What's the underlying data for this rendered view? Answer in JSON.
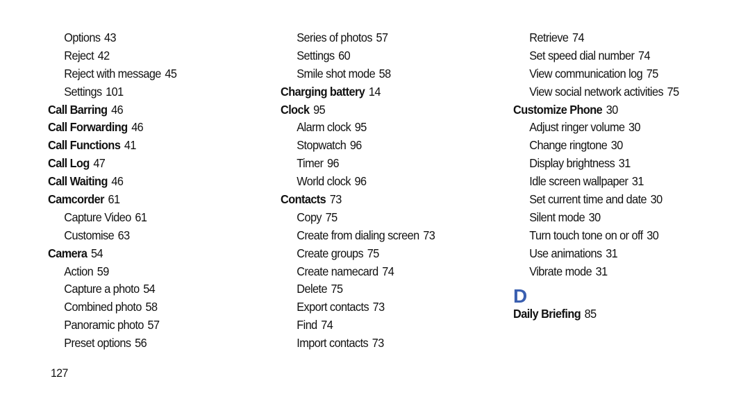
{
  "accent_color": "#3a5fb0",
  "columns": [
    {
      "entries": [
        {
          "term": "Options",
          "page": "43",
          "level": "sub"
        },
        {
          "term": "Reject",
          "page": "42",
          "level": "sub"
        },
        {
          "term": "Reject with message",
          "page": "45",
          "level": "sub"
        },
        {
          "term": "Settings",
          "page": "101",
          "level": "sub"
        },
        {
          "term": "Call Barring",
          "page": "46",
          "level": "main"
        },
        {
          "term": "Call Forwarding",
          "page": "46",
          "level": "main"
        },
        {
          "term": "Call Functions",
          "page": "41",
          "level": "main"
        },
        {
          "term": "Call Log",
          "page": "47",
          "level": "main"
        },
        {
          "term": "Call Waiting",
          "page": "46",
          "level": "main"
        },
        {
          "term": "Camcorder",
          "page": "61",
          "level": "main"
        },
        {
          "term": "Capture Video",
          "page": "61",
          "level": "sub"
        },
        {
          "term": "Customise",
          "page": "63",
          "level": "sub"
        },
        {
          "term": "Camera",
          "page": "54",
          "level": "main"
        },
        {
          "term": "Action",
          "page": "59",
          "level": "sub"
        },
        {
          "term": "Capture a photo",
          "page": "54",
          "level": "sub"
        },
        {
          "term": "Combined photo",
          "page": "58",
          "level": "sub"
        },
        {
          "term": "Panoramic photo",
          "page": "57",
          "level": "sub"
        },
        {
          "term": "Preset options",
          "page": "56",
          "level": "sub"
        }
      ]
    },
    {
      "entries": [
        {
          "term": "Series of photos",
          "page": "57",
          "level": "sub"
        },
        {
          "term": "Settings",
          "page": "60",
          "level": "sub"
        },
        {
          "term": "Smile shot mode",
          "page": "58",
          "level": "sub"
        },
        {
          "term": "Charging battery",
          "page": "14",
          "level": "main"
        },
        {
          "term": "Clock",
          "page": "95",
          "level": "main"
        },
        {
          "term": "Alarm clock",
          "page": "95",
          "level": "sub"
        },
        {
          "term": "Stopwatch",
          "page": "96",
          "level": "sub"
        },
        {
          "term": "Timer",
          "page": "96",
          "level": "sub"
        },
        {
          "term": "World clock",
          "page": "96",
          "level": "sub"
        },
        {
          "term": "Contacts",
          "page": "73",
          "level": "main"
        },
        {
          "term": "Copy",
          "page": "75",
          "level": "sub"
        },
        {
          "term": "Create from dialing screen",
          "page": "73",
          "level": "sub"
        },
        {
          "term": "Create groups",
          "page": "75",
          "level": "sub"
        },
        {
          "term": "Create namecard",
          "page": "74",
          "level": "sub"
        },
        {
          "term": "Delete",
          "page": "75",
          "level": "sub"
        },
        {
          "term": "Export contacts",
          "page": "73",
          "level": "sub"
        },
        {
          "term": "Find",
          "page": "74",
          "level": "sub"
        },
        {
          "term": "Import contacts",
          "page": "73",
          "level": "sub"
        }
      ]
    },
    {
      "entries": [
        {
          "term": "Retrieve",
          "page": "74",
          "level": "sub"
        },
        {
          "term": "Set speed dial number",
          "page": "74",
          "level": "sub"
        },
        {
          "term": "View communication log",
          "page": "75",
          "level": "sub"
        },
        {
          "term": "View social network activities",
          "page": "75",
          "level": "sub"
        },
        {
          "term": "Customize Phone",
          "page": "30",
          "level": "main"
        },
        {
          "term": "Adjust ringer volume",
          "page": "30",
          "level": "sub"
        },
        {
          "term": "Change ringtone",
          "page": "30",
          "level": "sub"
        },
        {
          "term": "Display brightness",
          "page": "31",
          "level": "sub"
        },
        {
          "term": "Idle screen wallpaper",
          "page": "31",
          "level": "sub"
        },
        {
          "term": "Set current time and date",
          "page": "30",
          "level": "sub"
        },
        {
          "term": "Silent mode",
          "page": "30",
          "level": "sub"
        },
        {
          "term": "Turn touch tone on or off",
          "page": "30",
          "level": "sub"
        },
        {
          "term": "Use animations",
          "page": "31",
          "level": "sub"
        },
        {
          "term": "Vibrate mode",
          "page": "31",
          "level": "sub"
        },
        {
          "letter": "D"
        },
        {
          "term": "Daily Briefing",
          "page": "85",
          "level": "main"
        }
      ]
    }
  ],
  "page_number": "127"
}
